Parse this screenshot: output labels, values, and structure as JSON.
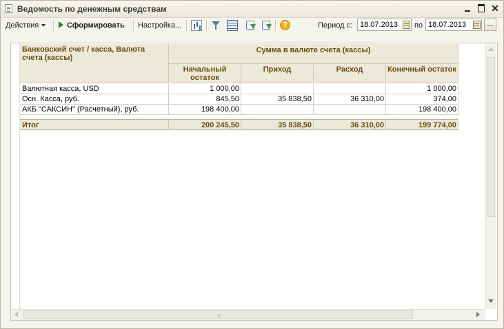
{
  "window": {
    "title": "Ведомость по денежным средствам"
  },
  "toolbar": {
    "actions_label": "Действия",
    "generate_label": "Сформировать",
    "settings_label": "Настройка...",
    "period_from_label": "Период с:",
    "period_from_value": "18.07.2013",
    "period_to_label": "по",
    "period_to_value": "18.07.2013",
    "more_label": "..."
  },
  "report": {
    "headers": {
      "account": "Банковский счет / касса, Валюта счета (кассы)",
      "group": "Сумма в валюте счета (кассы)",
      "opening": "Начальный остаток",
      "income": "Приход",
      "expense": "Расход",
      "closing": "Конечный остаток"
    },
    "rows": [
      {
        "account": "Валютная касса, USD",
        "opening": "1 000,00",
        "income": "",
        "expense": "",
        "closing": "1 000,00"
      },
      {
        "account": "Осн. Касса, руб.",
        "opening": "845,50",
        "income": "35 838,50",
        "expense": "36 310,00",
        "closing": "374,00"
      },
      {
        "account": "АКБ \"САКСИН\" (Расчетный), руб.",
        "opening": "198 400,00",
        "income": "",
        "expense": "",
        "closing": "198 400,00"
      }
    ],
    "total": {
      "label": "Итог",
      "opening": "200 245,50",
      "income": "35 838,50",
      "expense": "36 310,00",
      "closing": "199 774,00"
    }
  }
}
